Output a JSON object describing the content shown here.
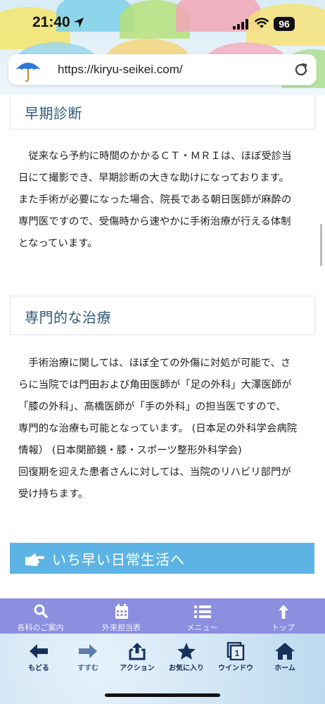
{
  "status_bar": {
    "time": "21:40",
    "battery": "96"
  },
  "browser": {
    "url": "https://kiryu-seikei.com/"
  },
  "sections": [
    {
      "title": "早期診断",
      "paragraph": "　従来なら予約に時間のかかるＣＴ・ＭＲＩは、ほぼ受診当\n日にて撮影でき、早期診断の大きな助けになっております。\nまた手術が必要になった場合、院長である朝日医師が麻酔の\n専門医ですので、受傷時から速やかに手術治療が行える体制\nとなっています。"
    },
    {
      "title": "専門的な治療",
      "paragraph": "　手術治療に関しては、ほぼ全ての外傷に対処が可能で、さ\nらに当院では門田および角田医師が「足の外科」大澤医師が\n「膝の外科」、髙橋医師が「手の外科」の担当医ですので、\n専門的な治療も可能となっています。 (日本足の外科学会病院\n情報） (日本関節鏡・膝・スポーツ整形外科学会)\n回復期を迎えた患者さんに対しては、当院のリハビリ部門が\n受け持ちます。"
    }
  ],
  "banner": {
    "text": "いち早い日常生活へ",
    "color": "#5db4e4"
  },
  "site_nav": {
    "color": "#8c8ee0",
    "items": [
      {
        "label": "各科のご案内",
        "icon": "search-icon"
      },
      {
        "label": "外来担当表",
        "icon": "calendar-icon"
      },
      {
        "label": "メニュー",
        "icon": "list-icon"
      },
      {
        "label": "トップ",
        "icon": "arrow-up-icon"
      }
    ]
  },
  "toolbar": {
    "items": [
      {
        "label": "もどる",
        "icon": "back-arrow-icon"
      },
      {
        "label": "すすむ",
        "icon": "forward-arrow-icon"
      },
      {
        "label": "アクション",
        "icon": "share-icon"
      },
      {
        "label": "お気に入り",
        "icon": "star-icon"
      },
      {
        "label": "ウインドウ",
        "icon": "windows-icon",
        "badge": "1"
      },
      {
        "label": "ホーム",
        "icon": "home-icon"
      }
    ]
  }
}
